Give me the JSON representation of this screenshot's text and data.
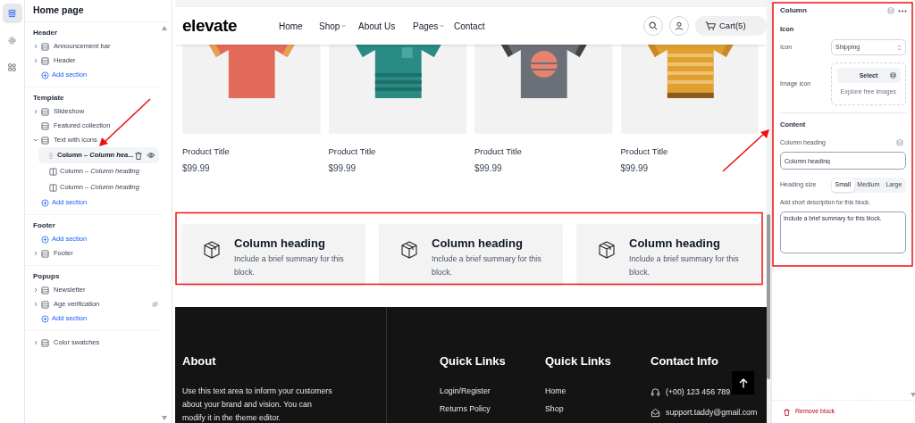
{
  "rail": [
    {
      "selected": true
    },
    {
      "selected": false
    },
    {
      "selected": false
    }
  ],
  "sidebar": {
    "title": "Home page",
    "groups": [
      {
        "title": "Header",
        "items": [
          {
            "kind": "section",
            "label": "Announcement bar",
            "expanded": false,
            "hidden": false
          },
          {
            "kind": "section",
            "label": "Header",
            "expanded": false,
            "hidden": false
          },
          {
            "kind": "add",
            "label": "Add section"
          }
        ]
      },
      {
        "title": "Template",
        "items": [
          {
            "kind": "section",
            "label": "Slideshow",
            "expanded": false,
            "hidden": false
          },
          {
            "kind": "plain",
            "label": "Featured collection"
          },
          {
            "kind": "section",
            "label": "Text with icons",
            "expanded": true,
            "hidden": false,
            "children": [
              {
                "kind": "block",
                "label": "Column – *Column hea...*",
                "selected": true
              },
              {
                "kind": "block",
                "label": "Column – *Column heading*",
                "selected": false
              },
              {
                "kind": "block",
                "label": "Column – *Column heading*",
                "selected": false
              }
            ]
          },
          {
            "kind": "add",
            "label": "Add section"
          }
        ]
      },
      {
        "title": "Footer",
        "items": [
          {
            "kind": "add",
            "label": "Add section"
          },
          {
            "kind": "section",
            "label": "Footer",
            "expanded": false,
            "hidden": false
          }
        ]
      },
      {
        "title": "Popups",
        "items": [
          {
            "kind": "section",
            "label": "Newsletter",
            "expanded": false,
            "hidden": false
          },
          {
            "kind": "section",
            "label": "Age verification",
            "expanded": false,
            "hidden": true
          },
          {
            "kind": "add",
            "label": "Add section"
          }
        ]
      },
      {
        "items": [
          {
            "kind": "section",
            "label": "Color swatches",
            "expanded": false,
            "hidden": false
          }
        ]
      }
    ]
  },
  "store": {
    "logo": "elevate",
    "nav": [
      {
        "label": "Home",
        "dropdown": false
      },
      {
        "label": "Shop",
        "dropdown": true
      },
      {
        "label": "About Us",
        "dropdown": false
      },
      {
        "label": "Pages",
        "dropdown": true
      },
      {
        "label": "Contact",
        "dropdown": false
      }
    ],
    "cart": "Cart(5)",
    "products": [
      {
        "title": "Product Title",
        "price": "$99.99"
      },
      {
        "title": "Product Title",
        "price": "$99.99"
      },
      {
        "title": "Product Title",
        "price": "$99.99"
      },
      {
        "title": "Product Title",
        "price": "$99.99"
      }
    ],
    "columns": [
      {
        "heading": "Column heading",
        "text": "Include a brief summary for this block."
      },
      {
        "heading": "Column heading",
        "text": "Include a brief summary for this block."
      },
      {
        "heading": "Column heading",
        "text": "Include a brief summary for this block."
      }
    ],
    "footer": {
      "about": {
        "heading": "About",
        "text": "Use this text area to inform your customers about your brand and vision. You can modify it in the theme editor."
      },
      "link_columns": [
        {
          "heading": "Quick Links",
          "links": [
            "Login/Register",
            "Returns Policy"
          ]
        },
        {
          "heading": "Quick Links",
          "links": [
            "Home",
            "Shop"
          ]
        }
      ],
      "contact": {
        "heading": "Contact Info",
        "items": [
          {
            "kind": "phone",
            "text": "(+00) 123 456 789"
          },
          {
            "kind": "email",
            "text": "support.taddy@gmail.com"
          }
        ]
      }
    }
  },
  "settings": {
    "title": "Column",
    "icon_group": {
      "heading": "Icon",
      "icon_label": "Icon",
      "icon_value": "Shipping",
      "image_label": "Image icon",
      "select_button": "Select",
      "explore_link": "Explore free images"
    },
    "content_group": {
      "heading": "Content",
      "heading_label": "Column heading",
      "heading_value": "Column heading",
      "size_label": "Heading size",
      "sizes": [
        {
          "label": "Small",
          "selected": true
        },
        {
          "label": "Medium",
          "selected": false
        },
        {
          "label": "Large",
          "selected": false
        }
      ],
      "description_label": "Add short description for this block.",
      "description_value": "Include a brief summary for this block."
    },
    "remove_button": "Remove block"
  }
}
